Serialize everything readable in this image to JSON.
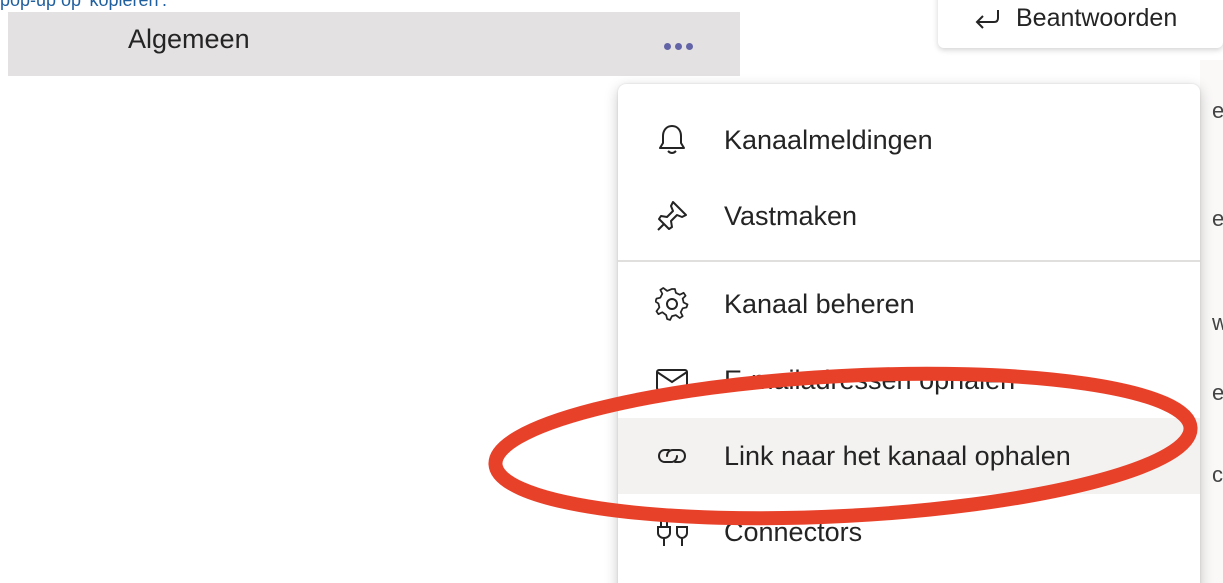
{
  "caption": "pop-up op 'kopiëren'.",
  "channel": {
    "name": "Algemeen",
    "more_icon": "more-dots-icon",
    "accent_color": "#6264a7"
  },
  "reply": {
    "label": "Beantwoorden",
    "icon": "reply-arrow-icon"
  },
  "background_chars": [
    "e",
    "e",
    "w",
    "e",
    "c"
  ],
  "menu": {
    "items": [
      {
        "label": "Kanaalmeldingen",
        "icon": "bell-icon"
      },
      {
        "label": "Vastmaken",
        "icon": "pin-icon"
      },
      {
        "label": "Kanaal beheren",
        "icon": "gear-icon"
      },
      {
        "label": "E-mailadressen ophalen",
        "icon": "mail-icon"
      },
      {
        "label": "Link naar het kanaal ophalen",
        "icon": "link-icon"
      },
      {
        "label": "Connectors",
        "icon": "connector-plug-icon"
      }
    ],
    "highlighted_index": 4
  },
  "annotation": {
    "shape": "ellipse",
    "color": "#e8412a"
  }
}
